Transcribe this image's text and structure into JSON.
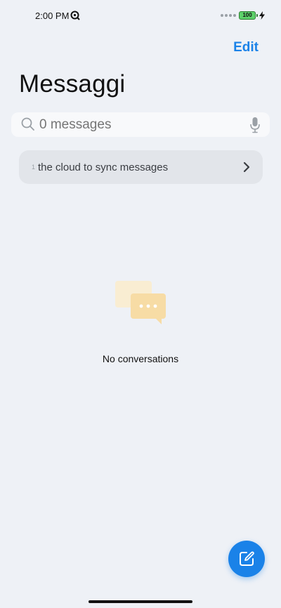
{
  "status_bar": {
    "time": "2:00 PM",
    "battery_level": "100",
    "app_icon": "q-search-icon",
    "charging_icon": "lightning-bolt-icon",
    "battery_color": "#5dd16a"
  },
  "header": {
    "edit_label": "Edit",
    "title": "Messaggi"
  },
  "search": {
    "placeholder": "0 messages",
    "search_icon": "magnifier-icon",
    "mic_icon": "microphone-icon"
  },
  "sync_banner": {
    "prefix": "1",
    "text": "the cloud to sync messages",
    "chevron_icon": "chevron-right-icon"
  },
  "empty_state": {
    "icon": "chat-bubbles-icon",
    "text": "No conversations"
  },
  "compose": {
    "icon": "compose-icon",
    "accent_color": "#1a82e8"
  }
}
